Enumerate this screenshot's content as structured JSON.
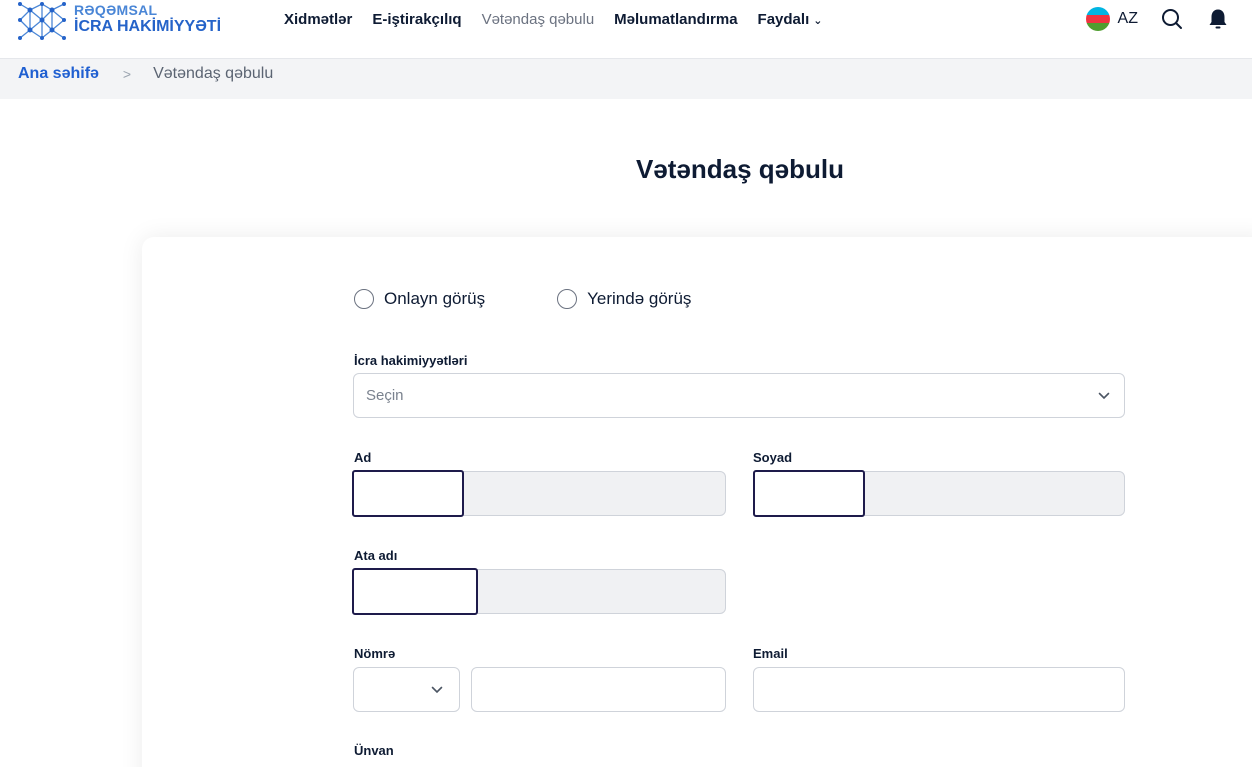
{
  "header": {
    "logo_line1": "RƏQƏMSAL",
    "logo_line2": "İCRA HAKİMİYYƏTİ",
    "nav": [
      "Xidmətlər",
      "E-iştirakçılıq",
      "Vətəndaş qəbulu",
      "Məlumatlandırma",
      "Faydalı"
    ],
    "language": "AZ"
  },
  "breadcrumb": {
    "home": "Ana səhifə",
    "separator": ">",
    "current": "Vətəndaş qəbulu"
  },
  "page": {
    "title": "Vətəndaş qəbulu"
  },
  "form": {
    "radio_online": "Onlayn görüş",
    "radio_onsite": "Yerində görüş",
    "executive_label": "İcra hakimiyyətləri",
    "executive_placeholder": "Seçin",
    "first_name_label": "Ad",
    "last_name_label": "Soyad",
    "father_name_label": "Ata adı",
    "phone_label": "Nömrə",
    "email_label": "Email",
    "address_label": "Ünvan"
  },
  "colors": {
    "brand_blue": "#1f5fd1",
    "text_dark": "#0e1b33",
    "focus_border": "#1e1b4b",
    "flag": [
      "#00b5e2",
      "#ef3340",
      "#509e2f"
    ]
  }
}
